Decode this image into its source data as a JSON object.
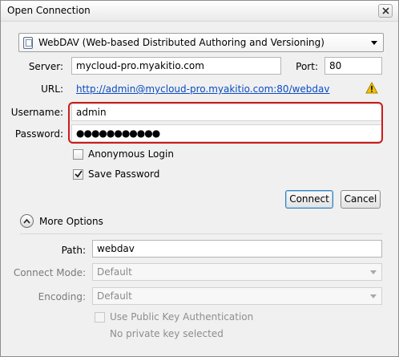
{
  "window": {
    "title": "Open Connection"
  },
  "protocol": {
    "selected": "WebDAV (Web-based Distributed Authoring and Versioning)"
  },
  "server": {
    "label": "Server:",
    "value": "mycloud-pro.myakitio.com"
  },
  "port": {
    "label": "Port:",
    "value": "80"
  },
  "url": {
    "label": "URL:",
    "value": "http://admin@mycloud-pro.myakitio.com:80/webdav"
  },
  "username": {
    "label": "Username:",
    "value": "admin"
  },
  "password": {
    "label": "Password:",
    "value": "●●●●●●●●●●●"
  },
  "anonymous_login": {
    "label": "Anonymous Login",
    "checked": false
  },
  "save_password": {
    "label": "Save Password",
    "checked": true
  },
  "buttons": {
    "connect": "Connect",
    "cancel": "Cancel"
  },
  "more_options": {
    "label": "More Options",
    "expanded": true
  },
  "path": {
    "label": "Path:",
    "value": "webdav"
  },
  "connect_mode": {
    "label": "Connect Mode:",
    "value": "Default"
  },
  "encoding": {
    "label": "Encoding:",
    "value": "Default"
  },
  "public_key": {
    "label": "Use Public Key Authentication",
    "checked": false,
    "hint": "No private key selected"
  },
  "colors": {
    "highlight": "#cc1b1b",
    "link": "#0b4cc0",
    "warning": "#f2c200"
  },
  "icons": {
    "close": "close-icon",
    "protocol": "disk-icon",
    "warning": "warning-icon",
    "collapse": "chevron-up-icon"
  }
}
